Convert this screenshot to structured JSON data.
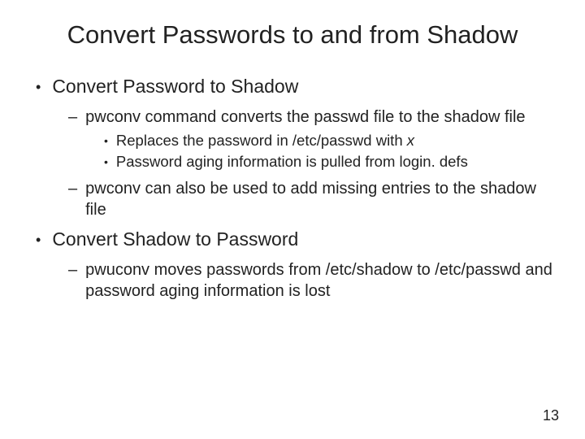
{
  "title": "Convert Passwords to and from Shadow",
  "b1_1": "Convert Password to Shadow",
  "b2_1": "pwconv command converts the passwd file to the shadow file",
  "b3_1_pre": "Replaces the password in /etc/passwd with ",
  "b3_1_it": "x",
  "b3_2": "Password aging information is pulled from login. defs",
  "b2_2": "pwconv can also be used to add missing entries to the shadow file",
  "b1_2": "Convert Shadow to Password",
  "b2_3": "pwuconv moves passwords from /etc/shadow to /etc/passwd and password aging information is lost",
  "page": "13"
}
